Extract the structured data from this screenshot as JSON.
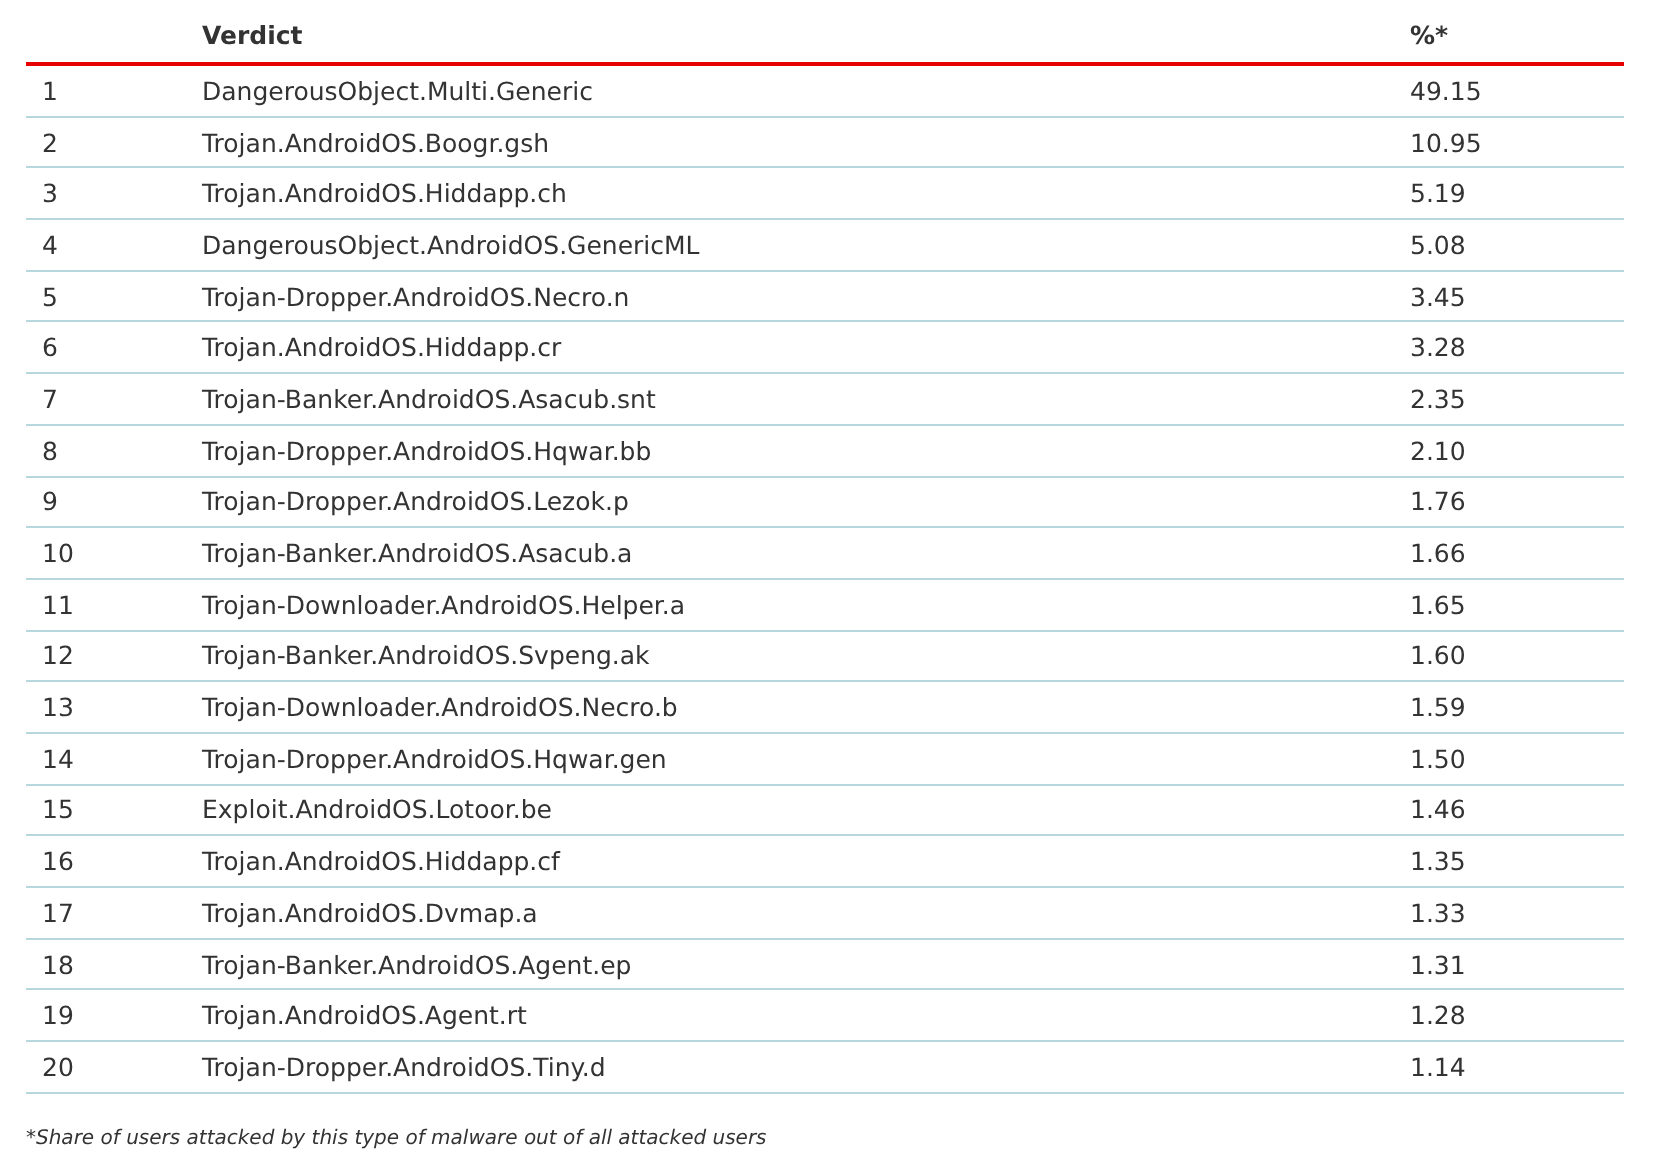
{
  "table": {
    "columns": [
      {
        "label": "Verdict"
      },
      {
        "label": "%*"
      }
    ],
    "rows": [
      {
        "rank": "1",
        "verdict": "DangerousObject.Multi.Generic",
        "percent": "49.15"
      },
      {
        "rank": "2",
        "verdict": "Trojan.AndroidOS.Boogr.gsh",
        "percent": "10.95"
      },
      {
        "rank": "3",
        "verdict": "Trojan.AndroidOS.Hiddapp.ch",
        "percent": "5.19"
      },
      {
        "rank": "4",
        "verdict": "DangerousObject.AndroidOS.GenericML",
        "percent": "5.08"
      },
      {
        "rank": "5",
        "verdict": "Trojan-Dropper.AndroidOS.Necro.n",
        "percent": "3.45"
      },
      {
        "rank": "6",
        "verdict": "Trojan.AndroidOS.Hiddapp.cr",
        "percent": "3.28"
      },
      {
        "rank": "7",
        "verdict": "Trojan-Banker.AndroidOS.Asacub.snt",
        "percent": "2.35"
      },
      {
        "rank": "8",
        "verdict": "Trojan-Dropper.AndroidOS.Hqwar.bb",
        "percent": "2.10"
      },
      {
        "rank": "9",
        "verdict": "Trojan-Dropper.AndroidOS.Lezok.p",
        "percent": "1.76"
      },
      {
        "rank": "10",
        "verdict": "Trojan-Banker.AndroidOS.Asacub.a",
        "percent": "1.66"
      },
      {
        "rank": "11",
        "verdict": "Trojan-Downloader.AndroidOS.Helper.a",
        "percent": "1.65"
      },
      {
        "rank": "12",
        "verdict": "Trojan-Banker.AndroidOS.Svpeng.ak",
        "percent": "1.60"
      },
      {
        "rank": "13",
        "verdict": "Trojan-Downloader.AndroidOS.Necro.b",
        "percent": "1.59"
      },
      {
        "rank": "14",
        "verdict": "Trojan-Dropper.AndroidOS.Hqwar.gen",
        "percent": "1.50"
      },
      {
        "rank": "15",
        "verdict": "Exploit.AndroidOS.Lotoor.be",
        "percent": "1.46"
      },
      {
        "rank": "16",
        "verdict": "Trojan.AndroidOS.Hiddapp.cf",
        "percent": "1.35"
      },
      {
        "rank": "17",
        "verdict": "Trojan.AndroidOS.Dvmap.a",
        "percent": "1.33"
      },
      {
        "rank": "18",
        "verdict": "Trojan-Banker.AndroidOS.Agent.ep",
        "percent": "1.31"
      },
      {
        "rank": "19",
        "verdict": "Trojan.AndroidOS.Agent.rt",
        "percent": "1.28"
      },
      {
        "rank": "20",
        "verdict": "Trojan-Dropper.AndroidOS.Tiny.d",
        "percent": "1.14"
      }
    ]
  },
  "footnote": "*Share of users attacked by this type of malware out of all attacked users"
}
